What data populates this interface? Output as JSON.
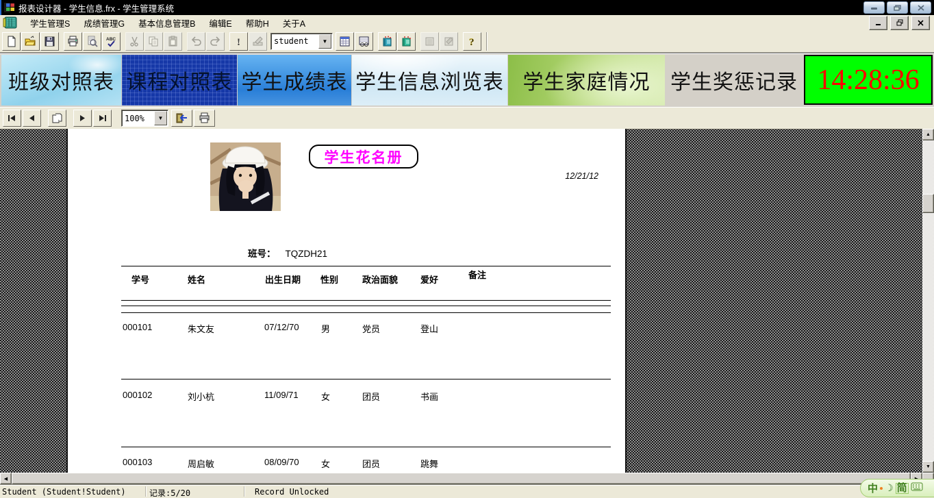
{
  "window": {
    "title": "报表设计器 - 学生信息.frx - 学生管理系统"
  },
  "menu": {
    "items": [
      {
        "label": "学生管理S"
      },
      {
        "label": "成绩管理G"
      },
      {
        "label": "基本信息管理B"
      },
      {
        "label": "编辑E"
      },
      {
        "label": "帮助H"
      },
      {
        "label": "关于A"
      }
    ]
  },
  "toolbar": {
    "dataset_combo": "student"
  },
  "banner": {
    "tabs": [
      {
        "label": "班级对照表",
        "selected": false
      },
      {
        "label": "课程对照表",
        "selected": true
      },
      {
        "label": "学生成绩表",
        "selected": false
      },
      {
        "label": "学生信息浏览表",
        "selected": false
      },
      {
        "label": "学生家庭情况",
        "selected": false
      },
      {
        "label": "学生奖惩记录",
        "selected": false
      }
    ],
    "clock": "14:28:36"
  },
  "preview": {
    "zoom": "100%"
  },
  "report": {
    "title": "学生花名册",
    "date": "12/21/12",
    "class_label": "班号：",
    "class_value": "TQZDH21",
    "columns": [
      "学号",
      "姓名",
      "出生日期",
      "性别",
      "政治面貌",
      "爱好",
      "备注"
    ],
    "rows": [
      {
        "id": "000101",
        "name": "朱文友",
        "birth": "07/12/70",
        "sex": "男",
        "politics": "党员",
        "hobby": "登山",
        "note": ""
      },
      {
        "id": "000102",
        "name": "刘小杭",
        "birth": "11/09/71",
        "sex": "女",
        "politics": "团员",
        "hobby": "书画",
        "note": ""
      },
      {
        "id": "000103",
        "name": "周启敏",
        "birth": "08/09/70",
        "sex": "女",
        "politics": "团员",
        "hobby": "跳舞",
        "note": ""
      }
    ]
  },
  "statusbar": {
    "dataset": "Student (Student!Student)",
    "record": "记录:5/20",
    "lock": "Record Unlocked"
  },
  "ime": {
    "lang": "中",
    "mode": "简"
  },
  "colors": {
    "clock_bg": "#00FF00",
    "clock_fg": "#FF0000",
    "report_title": "#FF00FF",
    "selected_tab_bg": "#1638A8",
    "titlebar_bg": "#000000"
  }
}
